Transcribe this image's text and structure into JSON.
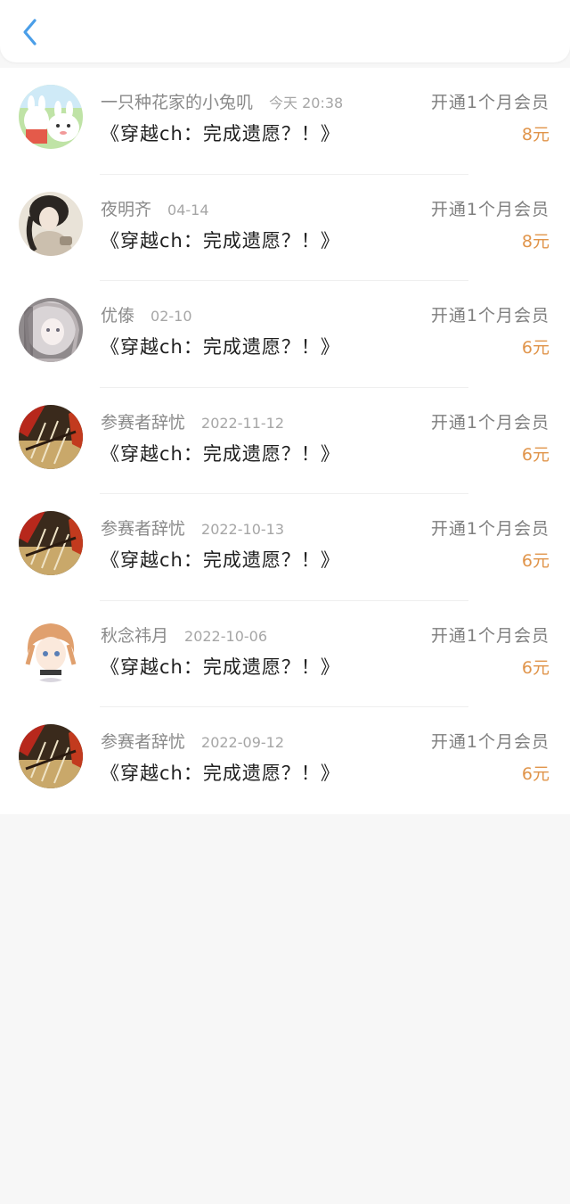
{
  "header": {
    "back_icon": "chevron-left-icon",
    "accent_color": "#4a9ee8"
  },
  "price_color": "#e0944a",
  "records": [
    {
      "name": "一只种花家的小兔叽",
      "date": "今天 20:38",
      "title": "《穿越ch：完成遗愿？！》",
      "action": "开通1个月会员",
      "price": "8元"
    },
    {
      "name": "夜明齐",
      "date": "04-14",
      "title": "《穿越ch：完成遗愿？！》",
      "action": "开通1个月会员",
      "price": "8元"
    },
    {
      "name": "优傣",
      "date": "02-10",
      "title": "《穿越ch：完成遗愿？！》",
      "action": "开通1个月会员",
      "price": "6元"
    },
    {
      "name": "参赛者辞忧",
      "date": "2022-11-12",
      "title": "《穿越ch：完成遗愿？！》",
      "action": "开通1个月会员",
      "price": "6元"
    },
    {
      "name": "参赛者辞忧",
      "date": "2022-10-13",
      "title": "《穿越ch：完成遗愿？！》",
      "action": "开通1个月会员",
      "price": "6元"
    },
    {
      "name": "秋念祎月",
      "date": "2022-10-06",
      "title": "《穿越ch：完成遗愿？！》",
      "action": "开通1个月会员",
      "price": "6元"
    },
    {
      "name": "参赛者辞忧",
      "date": "2022-09-12",
      "title": "《穿越ch：完成遗愿？！》",
      "action": "开通1个月会员",
      "price": "6元"
    }
  ]
}
